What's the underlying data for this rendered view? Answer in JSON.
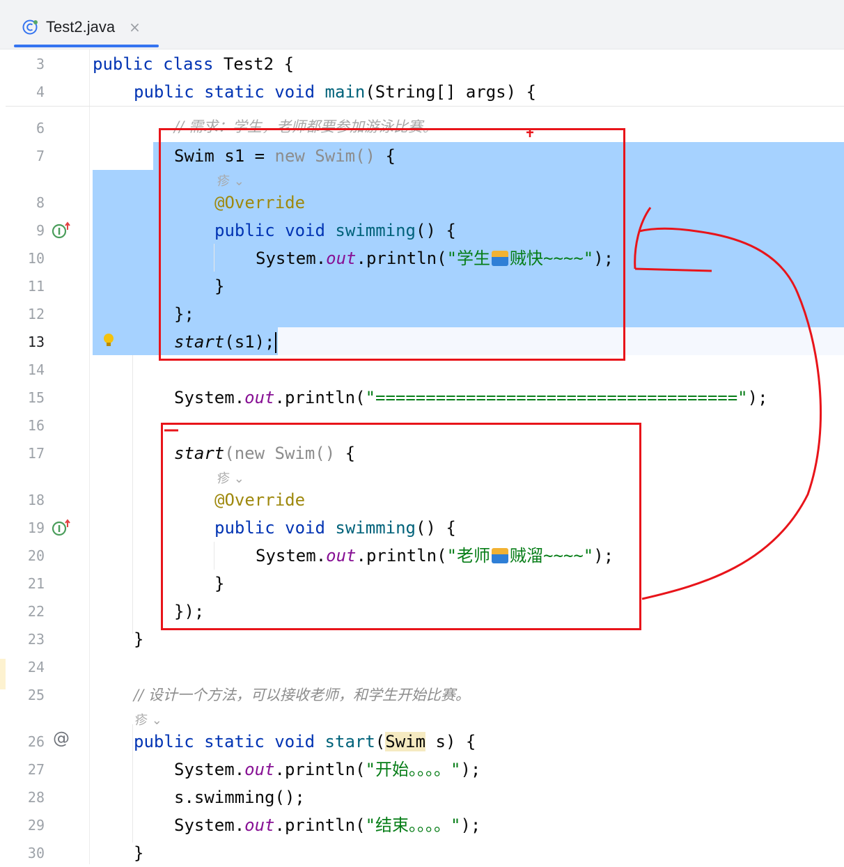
{
  "tab": {
    "title": "Test2.java",
    "close": "×"
  },
  "lines": [
    {
      "n": "3"
    },
    {
      "n": "4"
    },
    {
      "n": "6"
    },
    {
      "n": "7"
    },
    {
      "n": "8"
    },
    {
      "n": "9"
    },
    {
      "n": "10"
    },
    {
      "n": "11"
    },
    {
      "n": "12"
    },
    {
      "n": "13"
    },
    {
      "n": "14"
    },
    {
      "n": "15"
    },
    {
      "n": "16"
    },
    {
      "n": "17"
    },
    {
      "n": "18"
    },
    {
      "n": "19"
    },
    {
      "n": "20"
    },
    {
      "n": "21"
    },
    {
      "n": "22"
    },
    {
      "n": "23"
    },
    {
      "n": "24"
    },
    {
      "n": "25"
    },
    {
      "n": "26"
    },
    {
      "n": "27"
    },
    {
      "n": "28"
    },
    {
      "n": "29"
    },
    {
      "n": "30"
    }
  ],
  "code": {
    "l3": {
      "public": "public",
      "class": "class",
      "name": "Test2",
      "brace": "{"
    },
    "l4": {
      "mods": "public static void",
      "fn": "main",
      "params": "(String[] args) {"
    },
    "l6": "// 需求：学生，老师都要参加游泳比赛。",
    "l7": {
      "decl": "Swim s1 = ",
      "new": "new Swim()",
      "rest": " {"
    },
    "l8": "@Override",
    "l9": {
      "mods": "public void",
      "fn": "swimming",
      "rest": "() {"
    },
    "l10": {
      "pre": "System.",
      "field": "out",
      "mid": ".println(",
      "s1": "\"学生",
      "s2": "贼快~~~~\"",
      "end": ");"
    },
    "l11": "}",
    "l12": "};",
    "l13": {
      "call": "start",
      "args": "(s1);"
    },
    "l15": {
      "pre": "System.",
      "field": "out",
      "mid": ".println(",
      "str": "\"====================================\"",
      "end": ");"
    },
    "l17": {
      "call": "start",
      "new": "(new Swim()",
      "rest": " {"
    },
    "l18": "@Override",
    "l19": {
      "mods": "public void",
      "fn": "swimming",
      "rest": "() {"
    },
    "l20": {
      "pre": "System.",
      "field": "out",
      "mid": ".println(",
      "s1": "\"老师",
      "s2": "贼溜~~~~\"",
      "end": ");"
    },
    "l21": "}",
    "l22": "});",
    "l23": "}",
    "l25": "// 设计一个方法，可以接收老师，和学生开始比赛。",
    "l26": {
      "mods": "public static void",
      "fn": "start",
      "open": "(",
      "type": "Swim",
      "rest": " s) {"
    },
    "l27": {
      "pre": "System.",
      "field": "out",
      "mid": ".println(",
      "str": "\"开始。。。。\"",
      "end": ");"
    },
    "l28": "s.swimming();",
    "l29": {
      "pre": "System.",
      "field": "out",
      "mid": ".println(",
      "str": "\"结束。。。。\"",
      "end": ");"
    },
    "l30": "}"
  },
  "hints": {
    "author": "疹"
  },
  "gutter": {
    "implements_icon": "implements-icon",
    "at_icon": "@"
  },
  "colors": {
    "selection": "#a6d2ff",
    "annotation_red": "#e8141a",
    "keyword": "#0033b3",
    "string": "#067d17"
  }
}
